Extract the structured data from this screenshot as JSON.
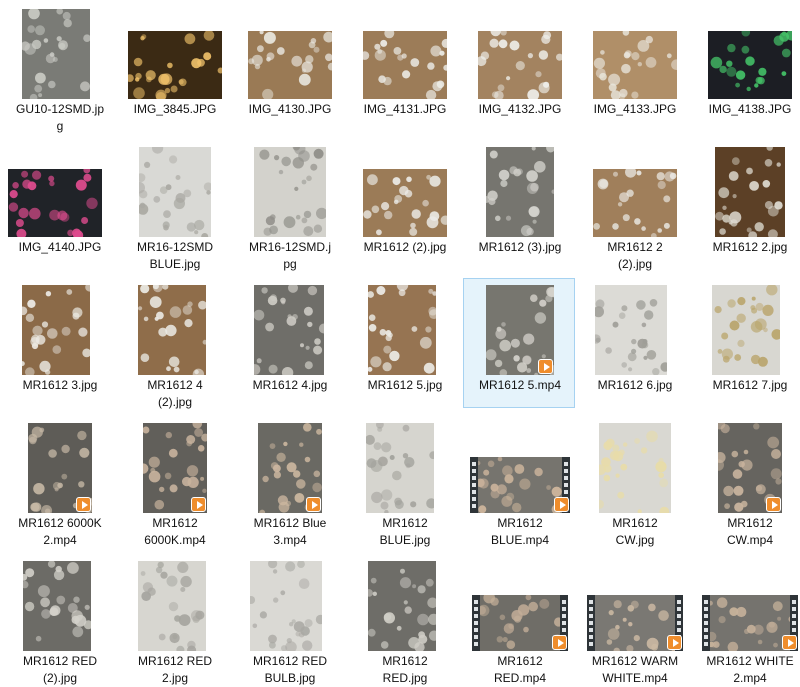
{
  "files": [
    {
      "name": "GU10-12SMD.jpg",
      "display": "GU10-12SMD.jp\ng",
      "kind": "jpg",
      "icon": "image-thumbnail",
      "palette": [
        "#7a7b76",
        "#c8c9c3"
      ]
    },
    {
      "name": "IMG_3845.JPG",
      "display": "IMG_3845.JPG",
      "kind": "jpg",
      "icon": "image-thumbnail",
      "palette": [
        "#3b2a14",
        "#f2c36b"
      ]
    },
    {
      "name": "IMG_4130.JPG",
      "display": "IMG_4130.JPG",
      "kind": "jpg",
      "icon": "image-thumbnail",
      "palette": [
        "#9a7a55",
        "#e9e7e0"
      ]
    },
    {
      "name": "IMG_4131.JPG",
      "display": "IMG_4131.JPG",
      "kind": "jpg",
      "icon": "image-thumbnail",
      "palette": [
        "#9c7c58",
        "#ecebe6"
      ]
    },
    {
      "name": "IMG_4132.JPG",
      "display": "IMG_4132.JPG",
      "kind": "jpg",
      "icon": "image-thumbnail",
      "palette": [
        "#a38360",
        "#eeeeea"
      ]
    },
    {
      "name": "IMG_4133.JPG",
      "display": "IMG_4133.JPG",
      "kind": "jpg",
      "icon": "image-thumbnail",
      "palette": [
        "#b08f68",
        "#e9e6dd"
      ]
    },
    {
      "name": "IMG_4138.JPG",
      "display": "IMG_4138.JPG",
      "kind": "jpg",
      "icon": "image-thumbnail",
      "palette": [
        "#1c1e24",
        "#45c76a"
      ]
    },
    {
      "name": "IMG_4140.JPG",
      "display": "IMG_4140.JPG",
      "kind": "jpg",
      "icon": "image-thumbnail",
      "palette": [
        "#202328",
        "#e04c8f"
      ]
    },
    {
      "name": "MR16-12SMD BLUE.jpg",
      "display": "MR16-12SMD\nBLUE.jpg",
      "kind": "jpg",
      "icon": "image-thumbnail",
      "palette": [
        "#d9d9d5",
        "#a9a8a2"
      ]
    },
    {
      "name": "MR16-12SMD.jpg",
      "display": "MR16-12SMD.j\npg",
      "kind": "jpg",
      "icon": "image-thumbnail",
      "palette": [
        "#d3d2cc",
        "#8f8e88"
      ]
    },
    {
      "name": "MR1612 (2).jpg",
      "display": "MR1612 (2).jpg",
      "kind": "jpg",
      "icon": "image-thumbnail",
      "palette": [
        "#9b7b57",
        "#ecebe7"
      ]
    },
    {
      "name": "MR1612 (3).jpg",
      "display": "MR1612 (3).jpg",
      "kind": "jpg",
      "icon": "image-thumbnail",
      "palette": [
        "#76756f",
        "#d2d1cb"
      ]
    },
    {
      "name": "MR1612 2 (2).jpg",
      "display": "MR1612 2\n(2).jpg",
      "kind": "jpg",
      "icon": "image-thumbnail",
      "palette": [
        "#a07f5b",
        "#ebeae5"
      ]
    },
    {
      "name": "MR1612 2.jpg",
      "display": "MR1612 2.jpg",
      "kind": "jpg",
      "icon": "image-thumbnail",
      "palette": [
        "#5c4026",
        "#e0ddd3"
      ]
    },
    {
      "name": "MR1612 3.jpg",
      "display": "MR1612 3.jpg",
      "kind": "jpg",
      "icon": "image-thumbnail",
      "palette": [
        "#8b6a48",
        "#eceae4"
      ]
    },
    {
      "name": "MR1612 4 (2).jpg",
      "display": "MR1612 4\n(2).jpg",
      "kind": "jpg",
      "icon": "image-thumbnail",
      "palette": [
        "#8f6d4a",
        "#ebe9e3"
      ]
    },
    {
      "name": "MR1612 4.jpg",
      "display": "MR1612 4.jpg",
      "kind": "jpg",
      "icon": "image-thumbnail",
      "palette": [
        "#6f6e69",
        "#cfcdc6"
      ]
    },
    {
      "name": "MR1612 5.jpg",
      "display": "MR1612 5.jpg",
      "kind": "jpg",
      "icon": "image-thumbnail",
      "palette": [
        "#967452",
        "#ecebe6"
      ]
    },
    {
      "name": "MR1612 5.mp4",
      "display": "MR1612 5.mp4",
      "kind": "mp4",
      "icon": "video-thumbnail",
      "selected": true,
      "palette": [
        "#77766f",
        "#d4d2cb"
      ]
    },
    {
      "name": "MR1612 6.jpg",
      "display": "MR1612 6.jpg",
      "kind": "jpg",
      "icon": "image-thumbnail",
      "palette": [
        "#dcdbd6",
        "#9e9d97"
      ]
    },
    {
      "name": "MR1612 7.jpg",
      "display": "MR1612 7.jpg",
      "kind": "jpg",
      "icon": "image-thumbnail",
      "palette": [
        "#d8d7d1",
        "#b9a46a"
      ]
    },
    {
      "name": "MR1612 6000K 2.mp4",
      "display": "MR1612 6000K\n2.mp4",
      "kind": "mp4",
      "icon": "video-thumbnail",
      "palette": [
        "#5e5c57",
        "#c6b8a5"
      ]
    },
    {
      "name": "MR1612 6000K.mp4",
      "display": "MR1612\n6000K.mp4",
      "kind": "mp4",
      "icon": "video-thumbnail",
      "palette": [
        "#615f5a",
        "#c8b39d"
      ]
    },
    {
      "name": "MR1612 Blue 3.mp4",
      "display": "MR1612 Blue\n3.mp4",
      "kind": "mp4",
      "icon": "video-thumbnail",
      "palette": [
        "#6a6963",
        "#cdb8a0"
      ]
    },
    {
      "name": "MR1612 BLUE.jpg",
      "display": "MR1612\nBLUE.jpg",
      "kind": "jpg",
      "icon": "image-thumbnail",
      "palette": [
        "#d6d5cf",
        "#a3a29c"
      ]
    },
    {
      "name": "MR1612 BLUE.mp4",
      "display": "MR1612\nBLUE.mp4",
      "kind": "mp4",
      "icon": "video-thumbnail",
      "film": true,
      "palette": [
        "#76746e",
        "#cdb59c"
      ]
    },
    {
      "name": "MR1612 CW.jpg",
      "display": "MR1612\nCW.jpg",
      "kind": "jpg",
      "icon": "image-thumbnail",
      "palette": [
        "#d9d8d2",
        "#e8dca8"
      ]
    },
    {
      "name": "MR1612 CW.mp4",
      "display": "MR1612\nCW.mp4",
      "kind": "mp4",
      "icon": "video-thumbnail",
      "palette": [
        "#66645f",
        "#c9b49e"
      ]
    },
    {
      "name": "MR1612 RED (2).jpg",
      "display": "MR1612 RED\n(2).jpg",
      "kind": "jpg",
      "icon": "image-thumbnail",
      "palette": [
        "#6c6b66",
        "#d3d1ca"
      ]
    },
    {
      "name": "MR1612 RED 2.jpg",
      "display": "MR1612 RED\n2.jpg",
      "kind": "jpg",
      "icon": "image-thumbnail",
      "palette": [
        "#d7d6d0",
        "#a5a49e"
      ]
    },
    {
      "name": "MR1612 RED BULB.jpg",
      "display": "MR1612 RED\nBULB.jpg",
      "kind": "jpg",
      "icon": "image-thumbnail",
      "palette": [
        "#dad9d4",
        "#a9a8a3"
      ]
    },
    {
      "name": "MR1612 RED.jpg",
      "display": "MR1612\nRED.jpg",
      "kind": "jpg",
      "icon": "image-thumbnail",
      "palette": [
        "#6e6d68",
        "#d0cec7"
      ]
    },
    {
      "name": "MR1612 RED.mp4",
      "display": "MR1612\nRED.mp4",
      "kind": "mp4",
      "icon": "video-thumbnail",
      "film": true,
      "palette": [
        "#6f6d67",
        "#c3ae98"
      ]
    },
    {
      "name": "MR1612 WARM WHITE.mp4",
      "display": "MR1612 WARM\nWHITE.mp4",
      "kind": "mp4",
      "icon": "video-thumbnail",
      "film": true,
      "palette": [
        "#7a7873",
        "#ccb9a3"
      ]
    },
    {
      "name": "MR1612 WHITE 2.mp4",
      "display": "MR1612 WHITE\n2.mp4",
      "kind": "mp4",
      "icon": "video-thumbnail",
      "film": true,
      "palette": [
        "#75736e",
        "#c7b29b"
      ]
    }
  ],
  "colors": {
    "selection_fill": "#e5f3fb",
    "selection_border": "#a6d2f1",
    "play_badge": "#ef8d2c"
  }
}
